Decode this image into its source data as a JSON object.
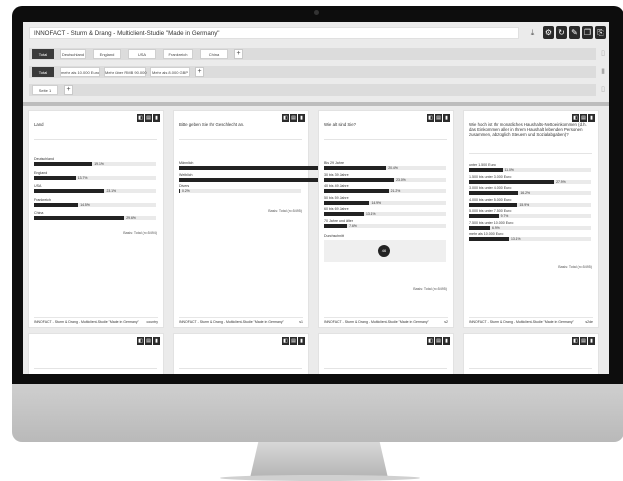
{
  "colors": {
    "bar": "#222222",
    "accent": "#2b2b2b"
  },
  "title": "INNOFACT - Sturm & Drang - Multiclient-Studie \"Made in Germany\"",
  "toolbar_icons": [
    "download-icon",
    "settings-icon",
    "refresh-icon",
    "edit-icon",
    "copy-icon",
    "export-icon"
  ],
  "filter_row1": {
    "items": [
      "Total",
      "Deutschland",
      "England",
      "USA",
      "Frankreich",
      "China"
    ],
    "add": "+"
  },
  "filter_row2": {
    "items": [
      "Total",
      "mehr als 10.000 Euro",
      "Mehr über RMB 90.000",
      "Mehr als 8.000 GBP"
    ],
    "add": "+"
  },
  "page_row": {
    "page": "Seite 1",
    "add": "+"
  },
  "cards": [
    {
      "question": "Land",
      "bars": [
        {
          "label": "Deutschland",
          "value": 19.1,
          "text": "19.1%"
        },
        {
          "label": "England",
          "value": 13.7,
          "text": "13.7%"
        },
        {
          "label": "USA",
          "value": 23.1,
          "text": "23.1%"
        },
        {
          "label": "Frankreich",
          "value": 14.5,
          "text": "14.5%"
        },
        {
          "label": "China",
          "value": 29.6,
          "text": "29.6%"
        }
      ],
      "basis": "Basis: Total (n=5494)",
      "footer": "INNOFACT - Sturm & Drang - Multiclient-Studie \"Made in Germany\"",
      "page": "country"
    },
    {
      "question": "Bitte geben Sie Ihr Geschlecht an.",
      "bars": [
        {
          "label": "Männlich",
          "value": 52.6,
          "text": "52.6%"
        },
        {
          "label": "Weiblich",
          "value": 46.9,
          "text": "46.9%"
        },
        {
          "label": "Divers",
          "value": 0.2,
          "text": "0.2%"
        }
      ],
      "basis": "Basis: Total (n=5495)",
      "footer": "INNOFACT - Sturm & Drang - Multiclient-Studie \"Made in Germany\"",
      "page": "s1"
    },
    {
      "question": "Wie alt sind Sie?",
      "bars": [
        {
          "label": "Bis 29 Jahre",
          "value": 20.4,
          "text": "20.4%"
        },
        {
          "label": "30 bis 39 Jahre",
          "value": 23.0,
          "text": "23.0%"
        },
        {
          "label": "40 bis 49 Jahre",
          "value": 21.2,
          "text": "21.2%"
        },
        {
          "label": "50 bis 59 Jahre",
          "value": 14.9,
          "text": "14.9%"
        },
        {
          "label": "60 bis 69 Jahre",
          "value": 13.1,
          "text": "13.1%"
        },
        {
          "label": "70 Jahre und älter",
          "value": 7.6,
          "text": "7.6%"
        }
      ],
      "avg_label": "Durchschnitt",
      "avg_value": "46",
      "basis": "Basis: Total (n=5495)",
      "footer": "INNOFACT - Sturm & Drang - Multiclient-Studie \"Made in Germany\"",
      "page": "s2"
    },
    {
      "question": "Wie hoch ist Ihr monatliches Haushalts-Nettoeinkommen (d.h. das Einkommen aller in Ihrem Haushalt lebenden Personen zusammen, abzüglich Steuern und Sozialabgaben)?",
      "bars": [
        {
          "label": "unter 1.500 Euro",
          "value": 11.0,
          "text": "11.0%"
        },
        {
          "label": "1.500 bis unter 3.000 Euro",
          "value": 27.9,
          "text": "27.9%"
        },
        {
          "label": "3.000 bis unter 4.000 Euro",
          "value": 16.2,
          "text": "16.2%"
        },
        {
          "label": "4.000 bis unter 5.000 Euro",
          "value": 15.9,
          "text": "15.9%"
        },
        {
          "label": "5.000 bis unter 7.500 Euro",
          "value": 9.7,
          "text": "9.7%"
        },
        {
          "label": "7.500 bis unter 10.000 Euro",
          "value": 6.9,
          "text": "6.9%"
        },
        {
          "label": "mehr als 10.000 Euro",
          "value": 13.1,
          "text": "13.1%"
        }
      ],
      "basis": "Basis: Total (n=5495)",
      "footer": "INNOFACT - Sturm & Drang - Multiclient-Studie \"Made in Germany\"",
      "page": "s2de"
    }
  ]
}
